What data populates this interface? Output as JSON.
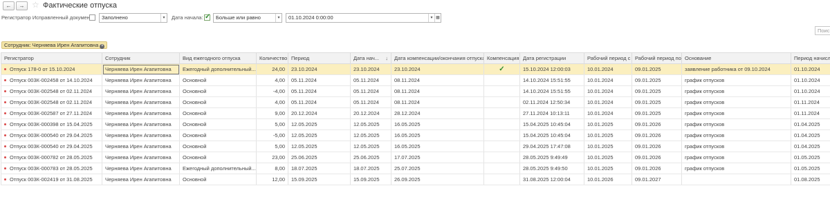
{
  "window": {
    "title": "Фактические отпуска",
    "back_icon": "←",
    "forward_icon": "→",
    "star_icon": "☆"
  },
  "filters": {
    "corrected_label": "Регистратор Исправленный документ:",
    "corrected_checked": false,
    "corrected_condition": "Заполнено",
    "start_label": "Дата начала:",
    "start_checked": true,
    "start_condition": "Больше или равно",
    "start_value": "01.10.2024  0:00:00",
    "search_placeholder": "Поиск (Ctrl+F)"
  },
  "chip": {
    "label": "Сотрудник: Черняева Ирен Агапитовна",
    "close": "×"
  },
  "table": {
    "columns": [
      "Регистратор",
      "Сотрудник",
      "Вид ежегодного отпуска",
      "Количество",
      "Период",
      "Дата нач...",
      "Дата компенсации/окончания отпуска",
      "Компенсация",
      "Дата регистрации",
      "Рабочий период с",
      "Рабочий период по",
      "Основание",
      "Период начисл"
    ],
    "sort_arrow": "↓",
    "rows": [
      [
        "Отпуск 178-0 от 15.10.2024",
        "Черняева Ирен Агапитовна",
        "Ежегодный дополнительный...",
        "24,00",
        "23.10.2024",
        "23.10.2024",
        "23.10.2024",
        "✓",
        "15.10.2024 12:00:03",
        "10.01.2024",
        "09.01.2025",
        "заявление работника от 09.10.2024",
        "01.10.2024"
      ],
      [
        "Отпуск 003К-002458 от 14.10.2024",
        "Черняева Ирен Агапитовна",
        "Основной",
        "4,00",
        "05.11.2024",
        "05.11.2024",
        "08.11.2024",
        "",
        "14.10.2024 15:51:55",
        "10.01.2024",
        "09.01.2025",
        "график отпусков",
        "01.10.2024"
      ],
      [
        "Отпуск 003К-002548 от 02.11.2024",
        "Черняева Ирен Агапитовна",
        "Основной",
        "-4,00",
        "05.11.2024",
        "05.11.2024",
        "08.11.2024",
        "",
        "14.10.2024 15:51:55",
        "10.01.2024",
        "09.01.2025",
        "график отпусков",
        "01.10.2024"
      ],
      [
        "Отпуск 003К-002548 от 02.11.2024",
        "Черняева Ирен Агапитовна",
        "Основной",
        "4,00",
        "05.11.2024",
        "05.11.2024",
        "08.11.2024",
        "",
        "02.11.2024 12:50:34",
        "10.01.2024",
        "09.01.2025",
        "график отпусков",
        "01.11.2024"
      ],
      [
        "Отпуск 003К-002587 от 27.11.2024",
        "Черняева Ирен Агапитовна",
        "Основной",
        "9,00",
        "20.12.2024",
        "20.12.2024",
        "28.12.2024",
        "",
        "27.11.2024 10:13:11",
        "10.01.2024",
        "09.01.2025",
        "график отпусков",
        "01.11.2024"
      ],
      [
        "Отпуск 003К-000398 от 15.04.2025",
        "Черняева Ирен Агапитовна",
        "Основной",
        "5,00",
        "12.05.2025",
        "12.05.2025",
        "16.05.2025",
        "",
        "15.04.2025 10:45:04",
        "10.01.2025",
        "09.01.2026",
        "график отпусков",
        "01.04.2025"
      ],
      [
        "Отпуск 003К-000540 от 29.04.2025",
        "Черняева Ирен Агапитовна",
        "Основной",
        "-5,00",
        "12.05.2025",
        "12.05.2025",
        "16.05.2025",
        "",
        "15.04.2025 10:45:04",
        "10.01.2025",
        "09.01.2026",
        "график отпусков",
        "01.04.2025"
      ],
      [
        "Отпуск 003К-000540 от 29.04.2025",
        "Черняева Ирен Агапитовна",
        "Основной",
        "5,00",
        "12.05.2025",
        "12.05.2025",
        "16.05.2025",
        "",
        "29.04.2025 17:47:08",
        "10.01.2025",
        "09.01.2026",
        "график отпусков",
        "01.04.2025"
      ],
      [
        "Отпуск 003К-000782 от 28.05.2025",
        "Черняева Ирен Агапитовна",
        "Основной",
        "23,00",
        "25.06.2025",
        "25.06.2025",
        "17.07.2025",
        "",
        "28.05.2025 9:49:49",
        "10.01.2025",
        "09.01.2026",
        "график отпусков",
        "01.05.2025"
      ],
      [
        "Отпуск 003К-000783 от 28.05.2025",
        "Черняева Ирен Агапитовна",
        "Ежегодный дополнительный...",
        "8,00",
        "18.07.2025",
        "18.07.2025",
        "25.07.2025",
        "",
        "28.05.2025 9:49:50",
        "10.01.2025",
        "09.01.2026",
        "график отпусков",
        "01.05.2025"
      ],
      [
        "Отпуск 003К-002419 от 31.08.2025",
        "Черняева Ирен Агапитовна",
        "Основной",
        "12,00",
        "15.09.2025",
        "15.09.2025",
        "26.09.2025",
        "",
        "31.08.2025 12:00:04",
        "10.01.2026",
        "09.01.2027",
        "",
        "01.08.2025"
      ]
    ]
  },
  "colors": {
    "selected_row": "#fbefbf",
    "chip_bg": "#f3e4a6",
    "check": "#2e8b2e",
    "row_marker": "#d94848"
  }
}
